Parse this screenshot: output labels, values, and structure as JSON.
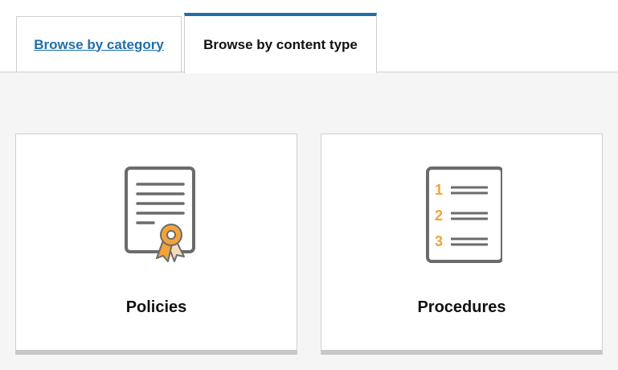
{
  "tabs": [
    {
      "label": "Browse by category",
      "active": false
    },
    {
      "label": "Browse by content type",
      "active": true
    }
  ],
  "cards": [
    {
      "title": "Policies",
      "icon": "certificate-document-icon"
    },
    {
      "title": "Procedures",
      "icon": "numbered-list-document-icon",
      "list_numbers": [
        "1",
        "2",
        "3"
      ]
    }
  ],
  "colors": {
    "accent": "#1f6fa8",
    "icon_stroke": "#6b6b6b",
    "icon_highlight": "#f2a33a",
    "panel_bg": "#f5f5f5"
  }
}
